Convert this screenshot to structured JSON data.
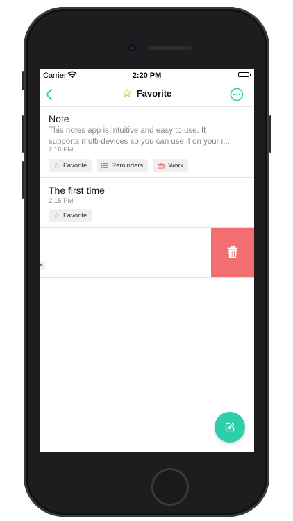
{
  "status_bar": {
    "carrier": "Carrier",
    "time": "2:20 PM",
    "battery_level": 1.0
  },
  "nav": {
    "title": "Favorite",
    "back_icon": "chevron-left-icon",
    "more_icon": "more-icon"
  },
  "notes": [
    {
      "title": "Note",
      "body_line1": "This notes app is intuitive and easy to use. It",
      "body_line2": "supports multi-devices so you can use it on your i...",
      "time": "2:16 PM",
      "tags": [
        "Favorite",
        "Reminders",
        "Work"
      ]
    },
    {
      "title": "The first time",
      "time": "2:15 PM",
      "tags": [
        "Favorite"
      ]
    }
  ],
  "swiped_row": {
    "edge_label": "e",
    "delete_icon": "trash-icon"
  },
  "colors": {
    "accent": "#2CCFA9",
    "delete": "#F36F6F",
    "star": "#F2C94C"
  }
}
